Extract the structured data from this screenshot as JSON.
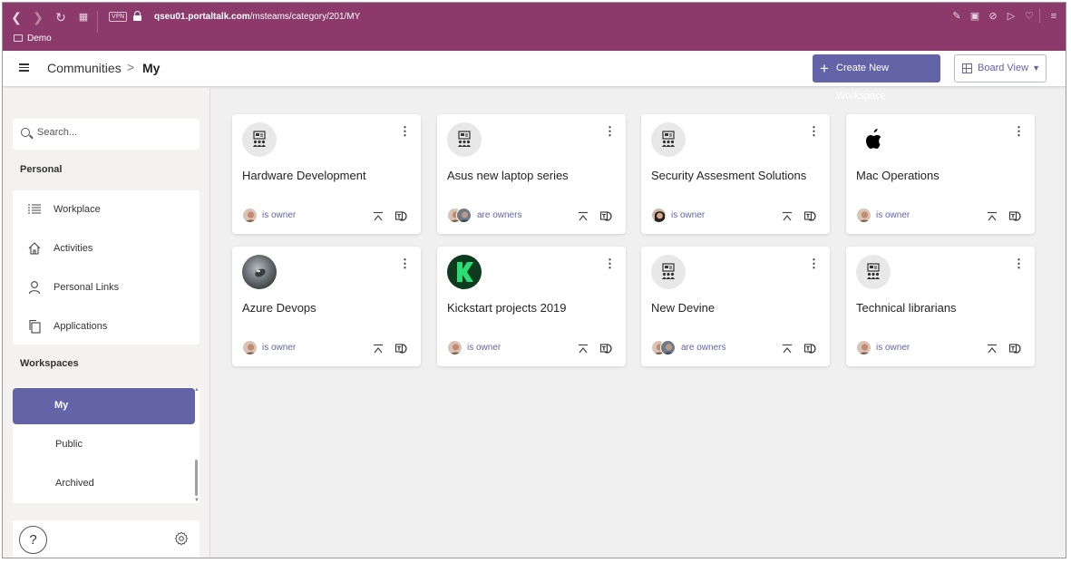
{
  "browser": {
    "vpn_label": "VPN",
    "url_domain": "qseu01.portaltalk.com",
    "url_path": "/msteams/category/201/MY",
    "bookmark": "Demo"
  },
  "header": {
    "breadcrumb_root": "Communities",
    "breadcrumb_sep": ">",
    "breadcrumb_current": "My",
    "create_label": "Create New Workspace",
    "view_label": "Board View"
  },
  "sidebar": {
    "search_placeholder": "Search...",
    "personal_label": "Personal",
    "personal_items": [
      {
        "label": "Workplace",
        "icon": "list-icon"
      },
      {
        "label": "Activities",
        "icon": "home-icon"
      },
      {
        "label": "Personal Links",
        "icon": "person-icon"
      },
      {
        "label": "Applications",
        "icon": "copy-icon"
      }
    ],
    "workspaces_label": "Workspaces",
    "workspace_items": [
      {
        "label": "My",
        "active": true
      },
      {
        "label": "Public",
        "active": false
      },
      {
        "label": "Archived",
        "active": false
      }
    ],
    "help_label": "?"
  },
  "cards": [
    {
      "title": "Hardware Development",
      "logo": "team-icon",
      "owners": "is owner",
      "avatars": 1
    },
    {
      "title": "Asus new laptop series",
      "logo": "team-icon",
      "owners": "are owners",
      "avatars": 2
    },
    {
      "title": "Security Assesment Solutions",
      "logo": "team-icon",
      "owners": "is owner",
      "avatars": 1
    },
    {
      "title": "Mac Operations",
      "logo": "apple-logo",
      "owners": "is owner",
      "avatars": 1
    },
    {
      "title": "Azure Devops",
      "logo": "photo-logo",
      "owners": "is owner",
      "avatars": 1
    },
    {
      "title": "Kickstart projects 2019",
      "logo": "kickstarter-logo",
      "owners": "is owner",
      "avatars": 1
    },
    {
      "title": "New Devine",
      "logo": "team-icon",
      "owners": "are owners",
      "avatars": 2
    },
    {
      "title": "Technical librarians",
      "logo": "team-icon",
      "owners": "is owner",
      "avatars": 1
    }
  ],
  "colors": {
    "browser_chrome": "#8b3a6b",
    "accent": "#6264a7",
    "background": "#f0f0f0"
  }
}
